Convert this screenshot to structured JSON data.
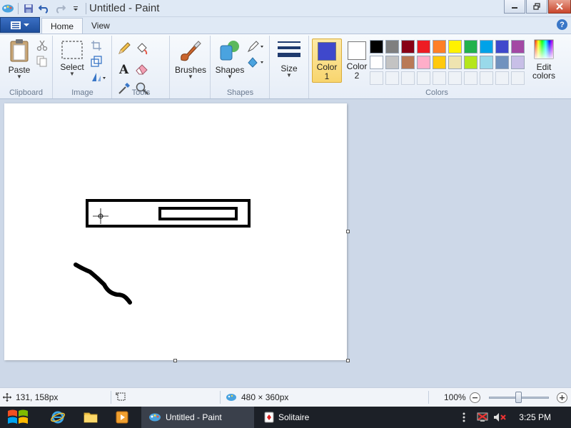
{
  "window": {
    "title": "Untitled - Paint"
  },
  "tabs": [
    {
      "label": "Home",
      "active": true
    },
    {
      "label": "View",
      "active": false
    }
  ],
  "ribbon": {
    "clipboard": {
      "group_label": "Clipboard",
      "paste_label": "Paste"
    },
    "image": {
      "group_label": "Image",
      "select_label": "Select"
    },
    "tools": {
      "group_label": "Tools"
    },
    "brushes": {
      "label": "Brushes"
    },
    "shapes": {
      "group_label": "Shapes",
      "shapes_label": "Shapes"
    },
    "size": {
      "label": "Size"
    },
    "colors": {
      "group_label": "Colors",
      "color1": {
        "label": "Color",
        "num": "1",
        "value": "#3f48cc"
      },
      "color2": {
        "label": "Color",
        "num": "2",
        "value": "#ffffff"
      },
      "edit_label": "Edit",
      "edit_label2": "colors",
      "palette": [
        "#000000",
        "#7f7f7f",
        "#880015",
        "#ed1c24",
        "#ff7f27",
        "#fff200",
        "#22b14c",
        "#00a2e8",
        "#3f48cc",
        "#a349a4",
        "#ffffff",
        "#c3c3c3",
        "#b97a57",
        "#ffaec9",
        "#ffc90e",
        "#efe4b0",
        "#b5e61d",
        "#99d9ea",
        "#7092be",
        "#c8bfe7",
        "",
        "",
        "",
        "",
        "",
        "",
        "",
        "",
        "",
        ""
      ]
    }
  },
  "status": {
    "cursor_pos": "131, 158px",
    "canvas_size": "480 × 360px",
    "zoom": "100%"
  },
  "taskbar": {
    "apps": [
      {
        "label": "Untitled - Paint",
        "active": true
      },
      {
        "label": "Solitaire",
        "active": false
      }
    ],
    "clock": "3:25 PM"
  },
  "colors": {
    "accent": "#3f48cc",
    "titlebar": "#dfe9f5",
    "taskbar": "#1c2027",
    "close": "#c9452b"
  }
}
